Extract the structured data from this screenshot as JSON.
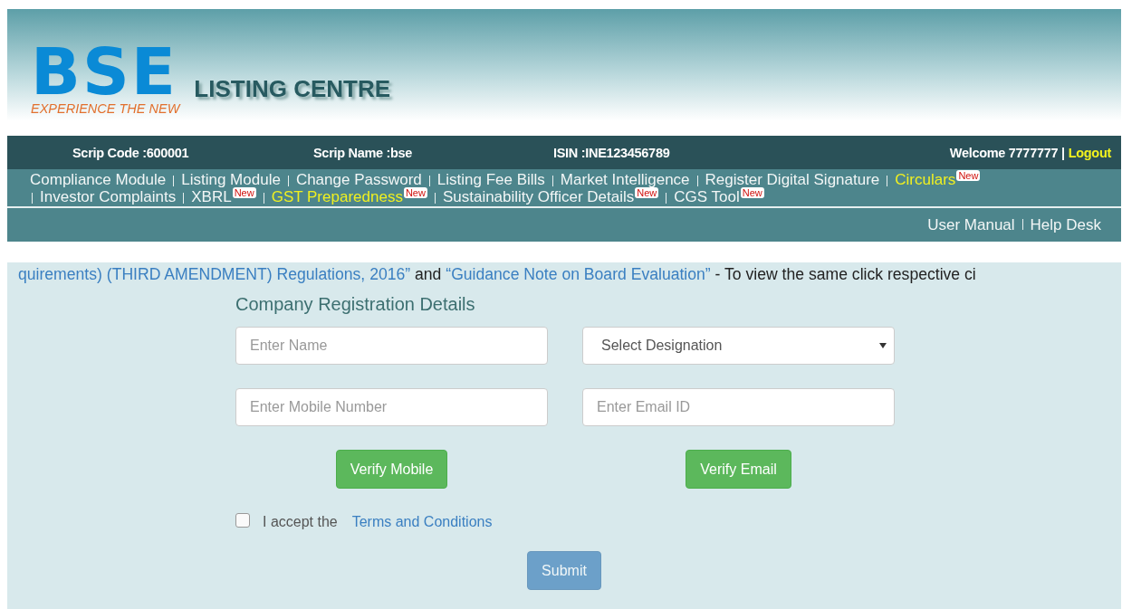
{
  "header": {
    "logo": "BSE",
    "tagline": "EXPERIENCE THE NEW",
    "title": "LISTING CENTRE"
  },
  "info_bar": {
    "scrip_code": "Scrip Code :600001",
    "scrip_name": "Scrip Name :bse",
    "isin": "ISIN :INE123456789",
    "welcome": "Welcome 7777777 |",
    "logout": "Logout"
  },
  "menu": {
    "rows": [
      [
        {
          "label": "Compliance Module",
          "highlighted": false
        },
        {
          "label": "Listing Module",
          "highlighted": false
        },
        {
          "label": "Change Password",
          "highlighted": false
        },
        {
          "label": "Listing Fee Bills",
          "highlighted": false
        },
        {
          "label": "Market Intelligence",
          "highlighted": false
        },
        {
          "label": "Register Digital Signature",
          "highlighted": false
        },
        {
          "label": "Circulars",
          "highlighted": true,
          "badge": "New"
        }
      ],
      [
        {
          "label": "Investor Complaints",
          "highlighted": false
        },
        {
          "label": "XBRL",
          "highlighted": false,
          "badge": "New"
        },
        {
          "label": "GST Preparedness",
          "highlighted": true,
          "badge": "New"
        },
        {
          "label": "Sustainability Officer Details",
          "highlighted": false,
          "badge": "New"
        },
        {
          "label": "CGS Tool",
          "highlighted": false,
          "badge": "New"
        }
      ]
    ],
    "links": [
      "User Manual",
      "Help Desk"
    ]
  },
  "ticker": [
    {
      "text": "quirements) (THIRD AMENDMENT) Regulations, 2016”",
      "kind": "link"
    },
    {
      "text": " and ",
      "kind": "text"
    },
    {
      "text": "“Guidance Note on Board Evaluation”",
      "kind": "link"
    },
    {
      "text": " - To view the same click respective ci",
      "kind": "text"
    }
  ],
  "form": {
    "title": "Company Registration Details",
    "fields": [
      {
        "kind": "input",
        "placeholder": "Enter Name"
      },
      {
        "kind": "select",
        "placeholder": "Select Designation"
      },
      {
        "kind": "input",
        "placeholder": "Enter Mobile Number"
      },
      {
        "kind": "input",
        "placeholder": "Enter Email ID"
      }
    ],
    "verify_buttons": [
      "Verify Mobile",
      "Verify Email"
    ],
    "terms": {
      "checked": false,
      "label": "I accept the",
      "link": "Terms and Conditions"
    },
    "submit": {
      "label": "Submit",
      "disabled": true
    }
  }
}
